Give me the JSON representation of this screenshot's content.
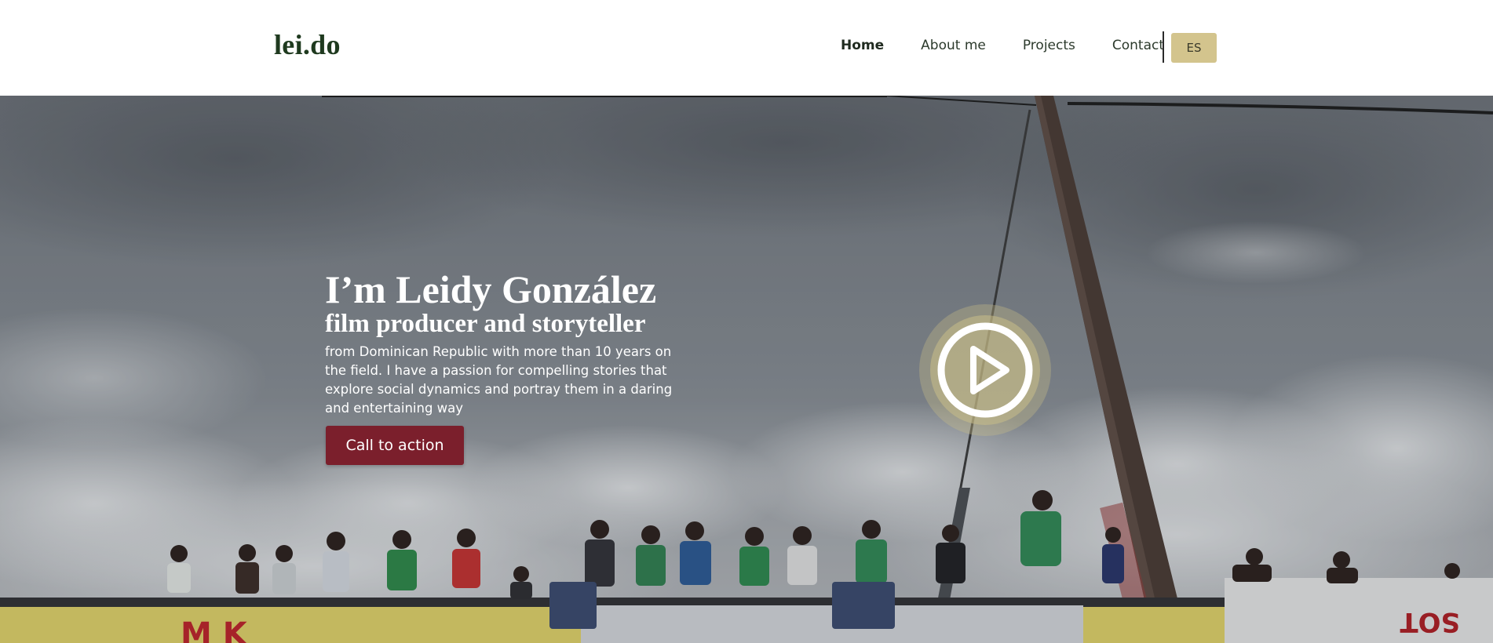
{
  "header": {
    "logo": "lei.do",
    "nav": [
      {
        "label": "Home",
        "active": true
      },
      {
        "label": "About me",
        "active": false
      },
      {
        "label": "Projects",
        "active": false
      },
      {
        "label": "Contact",
        "active": false
      }
    ],
    "language_button": "ES"
  },
  "hero": {
    "title": "I’m Leidy González",
    "subtitle": "film producer and storyteller",
    "description": "from Dominican Republic with more than 10 years on the field. I have a passion for compelling stories that explore social dynamics and portray them in a daring and entertaining way",
    "cta_label": "Call to action",
    "play_icon": "play-circle-icon"
  },
  "colors": {
    "brand_dark": "#1f3a1f",
    "accent_gold": "#d3c48d",
    "cta_red": "#7b1f2c"
  }
}
